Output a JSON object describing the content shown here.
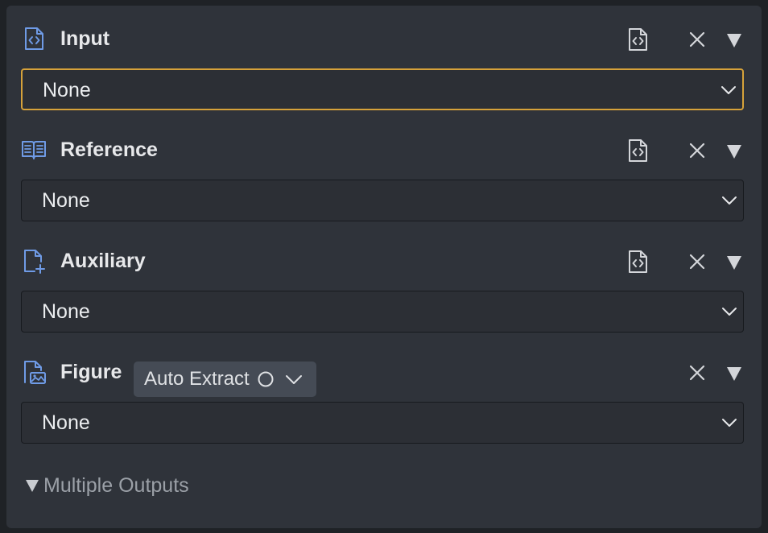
{
  "sections": [
    {
      "title": "Input",
      "icon": "code-file-icon",
      "value": "None",
      "focused": true
    },
    {
      "title": "Reference",
      "icon": "open-book-icon",
      "value": "None"
    },
    {
      "title": "Auxiliary",
      "icon": "add-file-icon",
      "value": "None"
    },
    {
      "title": "Figure",
      "icon": "image-file-icon",
      "value": "None",
      "mode_label": "Auto Extract"
    }
  ],
  "multiple_outputs_label": "Multiple Outputs",
  "colors": {
    "panel_bg": "#2f333a",
    "field_bg": "#2c2f35",
    "focus_border": "#d6a23a",
    "section_icon": "#6f9be6",
    "text": "#e7e8ea",
    "muted_text": "#9ba0a7",
    "chip_bg": "#454b55"
  }
}
